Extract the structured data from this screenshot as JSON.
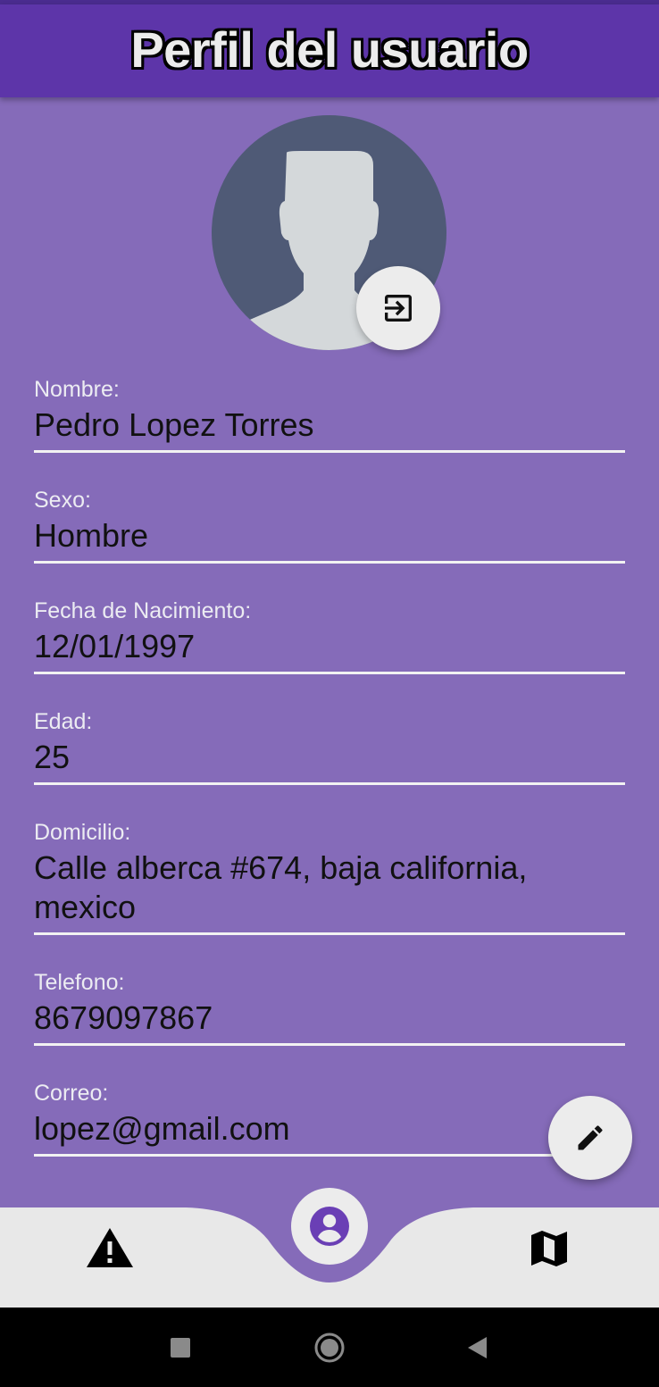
{
  "app_bar": {
    "title": "Perfil del usuario"
  },
  "profile": {
    "avatar_icon": "person-placeholder-icon",
    "logout_icon": "logout-icon"
  },
  "fields": [
    {
      "label": "Nombre:",
      "value": "Pedro Lopez Torres"
    },
    {
      "label": "Sexo:",
      "value": "Hombre"
    },
    {
      "label": "Fecha de Nacimiento:",
      "value": "12/01/1997"
    },
    {
      "label": "Edad:",
      "value": "25"
    },
    {
      "label": "Domicilio:",
      "value": "Calle alberca #674, baja california, mexico"
    },
    {
      "label": "Telefono:",
      "value": "8679097867"
    },
    {
      "label": "Correo:",
      "value": "lopez@gmail.com"
    }
  ],
  "fab": {
    "icon": "edit-pencil-icon"
  },
  "bottom_nav": {
    "items": [
      {
        "icon": "warning-icon"
      },
      {
        "icon": "account-circle-icon",
        "selected": true
      },
      {
        "icon": "map-icon"
      }
    ]
  },
  "system_nav": {
    "buttons": [
      "recents-square-icon",
      "home-circle-icon",
      "back-triangle-icon"
    ]
  },
  "colors": {
    "background": "#856bb9",
    "app_bar": "#5d35a9",
    "accent": "#6a3fb5",
    "surface": "#ececec"
  }
}
